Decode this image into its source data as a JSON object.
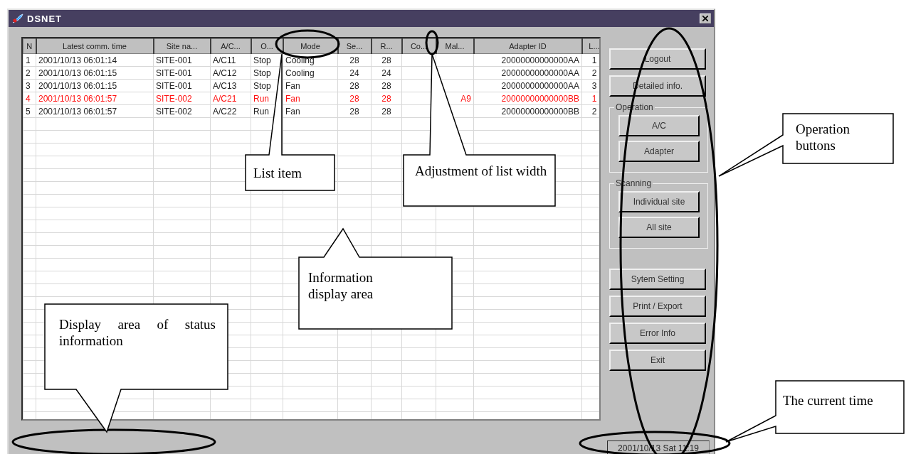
{
  "window": {
    "title": "DSNET"
  },
  "table": {
    "columns": [
      "N",
      "Latest comm. time",
      "Site na...",
      "A/C...",
      "O...",
      "Mode",
      "Se...",
      "R...",
      "Co...",
      "Mal...",
      "Adapter ID",
      "L..."
    ],
    "rows": [
      {
        "alarm": false,
        "cells": [
          "1",
          "2001/10/13 06:01:14",
          "SITE-001",
          "A/C11",
          "Stop",
          "Cooling",
          "28",
          "28",
          "",
          "",
          "20000000000000AA",
          "1"
        ]
      },
      {
        "alarm": false,
        "cells": [
          "2",
          "2001/10/13 06:01:15",
          "SITE-001",
          "A/C12",
          "Stop",
          "Cooling",
          "24",
          "24",
          "",
          "",
          "20000000000000AA",
          "2"
        ]
      },
      {
        "alarm": false,
        "cells": [
          "3",
          "2001/10/13 06:01:15",
          "SITE-001",
          "A/C13",
          "Stop",
          "Fan",
          "28",
          "28",
          "",
          "",
          "20000000000000AA",
          "3"
        ]
      },
      {
        "alarm": true,
        "cells": [
          "4",
          "2001/10/13 06:01:57",
          "SITE-002",
          "A/C21",
          "Run",
          "Fan",
          "28",
          "28",
          "",
          "A9",
          "20000000000000BB",
          "1"
        ]
      },
      {
        "alarm": false,
        "cells": [
          "5",
          "2001/10/13 06:01:57",
          "SITE-002",
          "A/C22",
          "Run",
          "Fan",
          "28",
          "28",
          "",
          "",
          "20000000000000BB",
          "2"
        ]
      }
    ]
  },
  "sidebar": [
    {
      "kind": "button",
      "label": "Logout"
    },
    {
      "kind": "button",
      "label": "Detailed info."
    },
    {
      "kind": "group",
      "title": "Operation",
      "buttons": [
        "A/C",
        "Adapter"
      ]
    },
    {
      "kind": "group",
      "title": "Scanning",
      "buttons": [
        "Individual site",
        "All site"
      ]
    },
    {
      "kind": "button",
      "label": "Sytem Setting"
    },
    {
      "kind": "button",
      "label": "Print / Export"
    },
    {
      "kind": "button",
      "label": "Error Info"
    },
    {
      "kind": "button",
      "label": "Exit"
    }
  ],
  "status_bar": {
    "time": "2001/10/13 Sat 11:19"
  },
  "callouts": [
    {
      "text": "List item"
    },
    {
      "text": "Adjustment of list width"
    },
    {
      "text": "Operation buttons"
    },
    {
      "text": "Information display area"
    },
    {
      "text": "Display area of status information"
    },
    {
      "text": "The current time"
    }
  ]
}
